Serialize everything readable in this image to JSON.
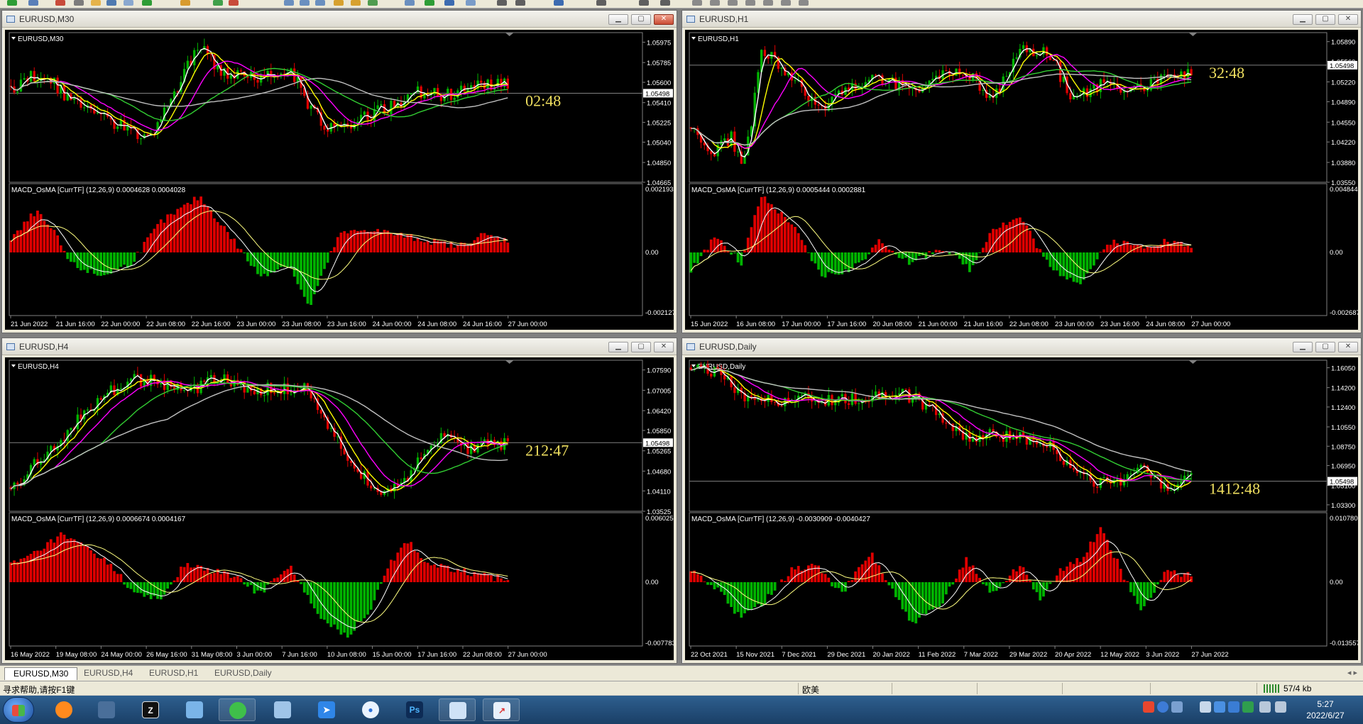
{
  "app": {
    "status_help": "寻求帮助,请按F1键",
    "status_profile": "欧美",
    "status_traffic": "57/4 kb",
    "clock_time": "5:27",
    "clock_date": "2022/6/27"
  },
  "tabs": [
    {
      "label": "EURUSD,M30",
      "active": true
    },
    {
      "label": "EURUSD,H4",
      "active": false
    },
    {
      "label": "EURUSD,H1",
      "active": false
    },
    {
      "label": "EURUSD,Daily",
      "active": false
    }
  ],
  "colors": {
    "bull": "#00b400",
    "bear": "#e00000",
    "ma_fast": "#ffffff",
    "ma_yellow": "#ffff00",
    "ma_magenta": "#ff00ff",
    "ma_green": "#32cd32",
    "ma_gray": "#c0c0c0",
    "timer": "#f0e060",
    "label": "#ffffff",
    "grid_line": "#808080"
  },
  "chart_data": [
    {
      "type": "candlestick",
      "title": "EURUSD,M30",
      "price_label": "EURUSD,M30",
      "timer": "02:48",
      "current_price": "1.05498",
      "yaxis_ticks": [
        "1.05975",
        "1.05785",
        "1.05600",
        "1.05410",
        "1.05225",
        "1.05040",
        "1.04850",
        "1.04665"
      ],
      "ylim": [
        1.04665,
        1.06065
      ],
      "current": 1.05498,
      "time_labels": [
        "21 Jun 2022",
        "21 Jun 16:00",
        "22 Jun 00:00",
        "22 Jun 08:00",
        "22 Jun 16:00",
        "23 Jun 00:00",
        "23 Jun 08:00",
        "23 Jun 16:00",
        "24 Jun 00:00",
        "24 Jun 08:00",
        "24 Jun 16:00",
        "27 Jun 00:00"
      ],
      "path": [
        [
          0,
          0.62
        ],
        [
          0.05,
          0.72
        ],
        [
          0.08,
          0.68
        ],
        [
          0.12,
          0.55
        ],
        [
          0.2,
          0.4
        ],
        [
          0.28,
          0.3
        ],
        [
          0.32,
          0.55
        ],
        [
          0.38,
          0.92
        ],
        [
          0.42,
          0.75
        ],
        [
          0.47,
          0.7
        ],
        [
          0.52,
          0.72
        ],
        [
          0.56,
          0.78
        ],
        [
          0.6,
          0.5
        ],
        [
          0.64,
          0.35
        ],
        [
          0.7,
          0.42
        ],
        [
          0.76,
          0.5
        ],
        [
          0.82,
          0.6
        ],
        [
          0.88,
          0.58
        ],
        [
          0.94,
          0.65
        ],
        [
          1,
          0.65
        ]
      ],
      "macd": {
        "label": "MACD_OsMA [CurrTF] (12,26,9) 0.0004628 0.0004028",
        "ticks": [
          "0.002193",
          "0.00",
          "-0.0021279"
        ],
        "hist": [
          [
            0,
            0.2
          ],
          [
            0.05,
            0.7
          ],
          [
            0.09,
            0.3
          ],
          [
            0.12,
            -0.2
          ],
          [
            0.18,
            -0.4
          ],
          [
            0.24,
            -0.2
          ],
          [
            0.3,
            0.5
          ],
          [
            0.38,
            0.95
          ],
          [
            0.44,
            0.3
          ],
          [
            0.5,
            -0.4
          ],
          [
            0.56,
            -0.2
          ],
          [
            0.6,
            -0.95
          ],
          [
            0.66,
            0.3
          ],
          [
            0.72,
            0.4
          ],
          [
            0.78,
            0.3
          ],
          [
            0.84,
            0.2
          ],
          [
            0.9,
            0.1
          ],
          [
            0.95,
            0.3
          ],
          [
            1,
            0.2
          ]
        ]
      }
    },
    {
      "type": "candlestick",
      "title": "EURUSD,H1",
      "price_label": "EURUSD,H1",
      "timer": "32:48",
      "current_price": "1.05498",
      "yaxis_ticks": [
        "1.05890",
        "1.05560",
        "1.05220",
        "1.04890",
        "1.04550",
        "1.04220",
        "1.03880",
        "1.03550"
      ],
      "ylim": [
        1.0355,
        1.0604
      ],
      "current": 1.05498,
      "time_labels": [
        "15 Jun 2022",
        "16 Jun 08:00",
        "17 Jun 00:00",
        "17 Jun 16:00",
        "20 Jun 08:00",
        "21 Jun 00:00",
        "21 Jun 16:00",
        "22 Jun 08:00",
        "23 Jun 00:00",
        "23 Jun 16:00",
        "24 Jun 08:00",
        "27 Jun 00:00"
      ],
      "path": [
        [
          0,
          0.35
        ],
        [
          0.04,
          0.2
        ],
        [
          0.08,
          0.3
        ],
        [
          0.1,
          0.15
        ],
        [
          0.12,
          0.35
        ],
        [
          0.14,
          0.9
        ],
        [
          0.2,
          0.7
        ],
        [
          0.26,
          0.5
        ],
        [
          0.32,
          0.62
        ],
        [
          0.38,
          0.7
        ],
        [
          0.44,
          0.6
        ],
        [
          0.5,
          0.72
        ],
        [
          0.55,
          0.75
        ],
        [
          0.6,
          0.55
        ],
        [
          0.66,
          0.88
        ],
        [
          0.72,
          0.85
        ],
        [
          0.76,
          0.55
        ],
        [
          0.82,
          0.65
        ],
        [
          0.88,
          0.6
        ],
        [
          0.94,
          0.7
        ],
        [
          1,
          0.72
        ]
      ],
      "macd": {
        "label": "MACD_OsMA [CurrTF] (12,26,9) 0.0005444 0.0002881",
        "ticks": [
          "0.0048447",
          "0.00",
          "-0.0026871"
        ],
        "hist": [
          [
            0,
            -0.3
          ],
          [
            0.05,
            0.3
          ],
          [
            0.1,
            -0.2
          ],
          [
            0.14,
            0.95
          ],
          [
            0.2,
            0.5
          ],
          [
            0.26,
            -0.4
          ],
          [
            0.32,
            -0.3
          ],
          [
            0.38,
            0.2
          ],
          [
            0.44,
            -0.2
          ],
          [
            0.5,
            0.1
          ],
          [
            0.56,
            -0.3
          ],
          [
            0.6,
            0.4
          ],
          [
            0.66,
            0.6
          ],
          [
            0.72,
            -0.3
          ],
          [
            0.78,
            -0.5
          ],
          [
            0.84,
            0.2
          ],
          [
            0.9,
            0.1
          ],
          [
            0.95,
            0.2
          ],
          [
            1,
            0.1
          ]
        ]
      }
    },
    {
      "type": "candlestick",
      "title": "EURUSD,H4",
      "price_label": "EURUSD,H4",
      "timer": "212:47",
      "current_price": "1.05498",
      "yaxis_ticks": [
        "1.07590",
        "1.07005",
        "1.06420",
        "1.05850",
        "1.05265",
        "1.04680",
        "1.04110",
        "1.03525"
      ],
      "ylim": [
        1.03525,
        1.0787
      ],
      "current": 1.05498,
      "time_labels": [
        "16 May 2022",
        "19 May 08:00",
        "24 May 00:00",
        "26 May 16:00",
        "31 May 08:00",
        "3 Jun 00:00",
        "7 Jun 16:00",
        "10 Jun 08:00",
        "15 Jun 00:00",
        "17 Jun 16:00",
        "22 Jun 08:00",
        "27 Jun 00:00"
      ],
      "path": [
        [
          0,
          0.15
        ],
        [
          0.06,
          0.35
        ],
        [
          0.12,
          0.55
        ],
        [
          0.18,
          0.75
        ],
        [
          0.24,
          0.88
        ],
        [
          0.3,
          0.85
        ],
        [
          0.36,
          0.8
        ],
        [
          0.42,
          0.88
        ],
        [
          0.48,
          0.82
        ],
        [
          0.54,
          0.8
        ],
        [
          0.6,
          0.82
        ],
        [
          0.64,
          0.55
        ],
        [
          0.7,
          0.25
        ],
        [
          0.76,
          0.12
        ],
        [
          0.8,
          0.2
        ],
        [
          0.84,
          0.45
        ],
        [
          0.88,
          0.5
        ],
        [
          0.92,
          0.42
        ],
        [
          0.96,
          0.45
        ],
        [
          1,
          0.45
        ]
      ],
      "macd": {
        "label": "MACD_OsMA [CurrTF] (12,26,9) 0.0006674 0.0004167",
        "ticks": [
          "0.0060256",
          "0.00",
          "-0.0077833"
        ],
        "hist": [
          [
            0,
            0.3
          ],
          [
            0.05,
            0.5
          ],
          [
            0.1,
            0.8
          ],
          [
            0.15,
            0.6
          ],
          [
            0.2,
            0.3
          ],
          [
            0.25,
            -0.2
          ],
          [
            0.3,
            -0.3
          ],
          [
            0.35,
            0.3
          ],
          [
            0.4,
            0.2
          ],
          [
            0.45,
            0.1
          ],
          [
            0.5,
            -0.2
          ],
          [
            0.56,
            0.3
          ],
          [
            0.62,
            -0.6
          ],
          [
            0.68,
            -0.9
          ],
          [
            0.72,
            -0.5
          ],
          [
            0.76,
            0.3
          ],
          [
            0.8,
            0.7
          ],
          [
            0.84,
            0.3
          ],
          [
            0.9,
            0.2
          ],
          [
            0.95,
            0.1
          ],
          [
            1,
            0.05
          ]
        ]
      }
    },
    {
      "type": "candlestick",
      "title": "EURUSD,Daily",
      "price_label": "EURUSD,Daily",
      "timer": "1412:48",
      "current_price": "1.05498",
      "yaxis_ticks": [
        "1.16050",
        "1.14200",
        "1.12400",
        "1.10550",
        "1.08750",
        "1.06950",
        "1.05100",
        "1.03300"
      ],
      "ylim": [
        1.027,
        1.1675
      ],
      "current": 1.05498,
      "time_labels": [
        "22 Oct 2021",
        "15 Nov 2021",
        "7 Dec 2021",
        "29 Dec 2021",
        "20 Jan 2022",
        "11 Feb 2022",
        "7 Mar 2022",
        "29 Mar 2022",
        "20 Apr 2022",
        "12 May 2022",
        "3 Jun 2022",
        "27 Jun 2022"
      ],
      "path": [
        [
          0,
          0.95
        ],
        [
          0.05,
          0.92
        ],
        [
          0.1,
          0.78
        ],
        [
          0.16,
          0.72
        ],
        [
          0.22,
          0.74
        ],
        [
          0.28,
          0.73
        ],
        [
          0.34,
          0.75
        ],
        [
          0.4,
          0.78
        ],
        [
          0.44,
          0.76
        ],
        [
          0.5,
          0.62
        ],
        [
          0.55,
          0.48
        ],
        [
          0.6,
          0.52
        ],
        [
          0.66,
          0.48
        ],
        [
          0.72,
          0.42
        ],
        [
          0.78,
          0.25
        ],
        [
          0.82,
          0.18
        ],
        [
          0.86,
          0.2
        ],
        [
          0.9,
          0.32
        ],
        [
          0.94,
          0.15
        ],
        [
          1,
          0.22
        ]
      ],
      "macd": {
        "label": "MACD_OsMA [CurrTF] (12,26,9) -0.0030909 -0.0040427",
        "ticks": [
          "0.0107807",
          "0.00",
          "-0.0135574"
        ],
        "hist": [
          [
            0,
            0.2
          ],
          [
            0.05,
            -0.1
          ],
          [
            0.1,
            -0.6
          ],
          [
            0.15,
            -0.3
          ],
          [
            0.2,
            0.2
          ],
          [
            0.25,
            0.3
          ],
          [
            0.3,
            -0.2
          ],
          [
            0.36,
            0.5
          ],
          [
            0.4,
            -0.1
          ],
          [
            0.44,
            -0.7
          ],
          [
            0.5,
            -0.4
          ],
          [
            0.55,
            0.4
          ],
          [
            0.6,
            -0.2
          ],
          [
            0.66,
            0.3
          ],
          [
            0.7,
            -0.3
          ],
          [
            0.74,
            0.2
          ],
          [
            0.78,
            0.4
          ],
          [
            0.82,
            0.9
          ],
          [
            0.86,
            0.2
          ],
          [
            0.9,
            -0.5
          ],
          [
            0.95,
            0.2
          ],
          [
            1,
            0.1
          ]
        ]
      }
    }
  ],
  "taskbar": {
    "apps": [
      "start",
      "browser",
      "network",
      "text-editor",
      "computer",
      "wechat",
      "notes",
      "arrow",
      "baidu",
      "ps",
      "explorer",
      "mt4"
    ],
    "ps_label": "Ps"
  }
}
